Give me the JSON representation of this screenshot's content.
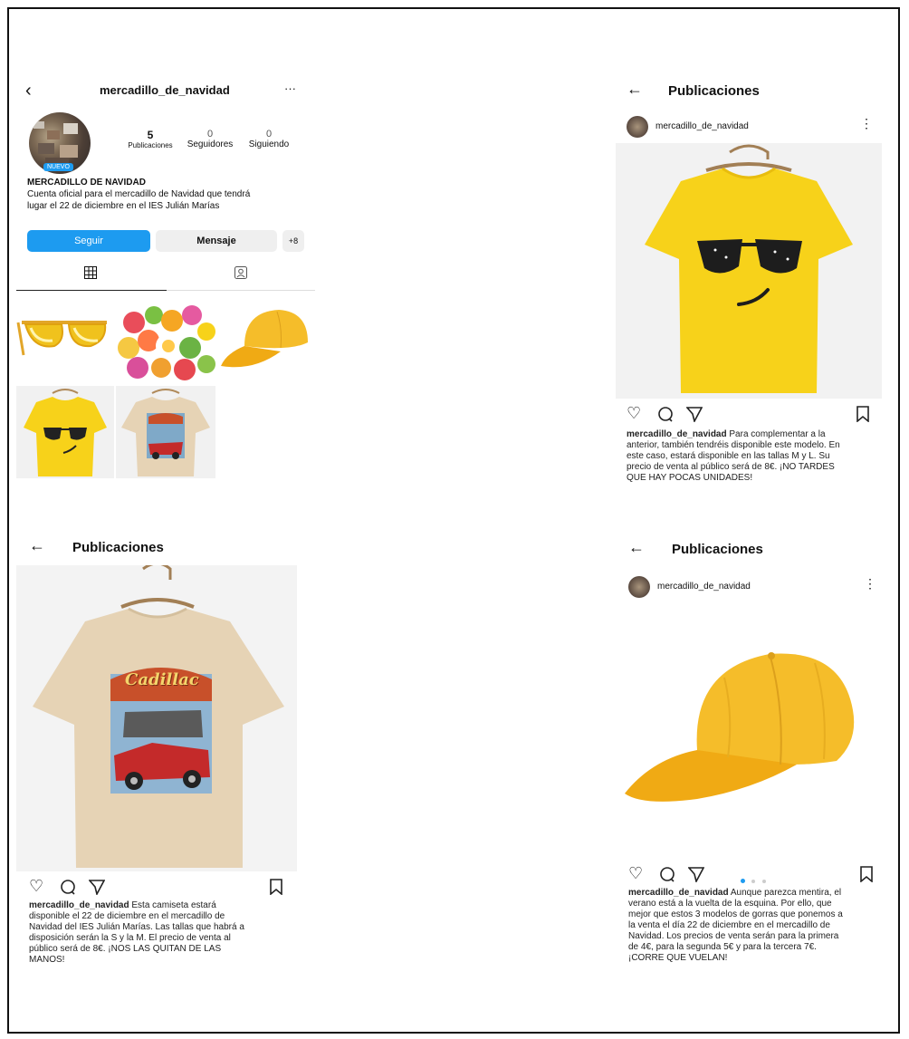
{
  "profile": {
    "username": "mercadillo_de_navidad",
    "more": "···",
    "stats": [
      {
        "value": "5",
        "label": "Publicaciones"
      },
      {
        "value": "0",
        "label": "Seguidores"
      },
      {
        "value": "0",
        "label": "Siguiendo"
      }
    ],
    "badge": "NUEVO",
    "display_name": "MERCADILLO DE NAVIDAD",
    "bio_line1": "Cuenta oficial para el mercadillo de Navidad que tendrá",
    "bio_line2": "lugar el 22 de diciembre en el IES Julián Marías",
    "follow_label": "Seguir",
    "message_label": "Mensaje",
    "add_person_label": "+8"
  },
  "post_tshirt_yellow": {
    "header_title": "Publicaciones",
    "username": "mercadillo_de_navidad",
    "caption_user": "mercadillo_de_navidad",
    "caption_lines": [
      "Para complementar a la",
      "anterior, también tendréis disponible este modelo. En",
      "este caso, estará disponible en las tallas M y L. Su",
      "precio de venta al público será de 8€. ¡NO TARDES",
      "QUE HAY POCAS UNIDADES!"
    ]
  },
  "post_tshirt_beige": {
    "header_title": "Publicaciones",
    "caption_user": "mercadillo_de_navidad",
    "caption_lines": [
      "Esta camiseta estará",
      "disponible el 22 de diciembre en el mercadillo de",
      "Navidad del IES Julián Marías. Las tallas que habrá a",
      "disposición serán la S y la M. El precio de venta al",
      "público será de 8€. ¡NOS LAS QUITAN DE LAS",
      "MANOS!"
    ],
    "print_text": "Cadillac"
  },
  "post_cap": {
    "header_title": "Publicaciones",
    "username": "mercadillo_de_navidad",
    "caption_user": "mercadillo_de_navidad",
    "caption_lines": [
      "Aunque parezca mentira, el",
      "verano está a la vuelta de la esquina. Por ello, que",
      "mejor que estos 3 modelos de gorras que ponemos a",
      "la venta el día 22 de diciembre en el mercadillo de",
      "Navidad. Los precios de venta serán para la primera",
      "de 4€, para la segunda 5€ y para la tercera 7€.",
      "¡CORRE QUE VUELAN!"
    ]
  },
  "colors": {
    "accent_blue": "#1d9bf0",
    "shirt_yellow": "#f7d21a",
    "shirt_beige": "#e6d3b5",
    "cap_yellow": "#f5bd2a"
  }
}
